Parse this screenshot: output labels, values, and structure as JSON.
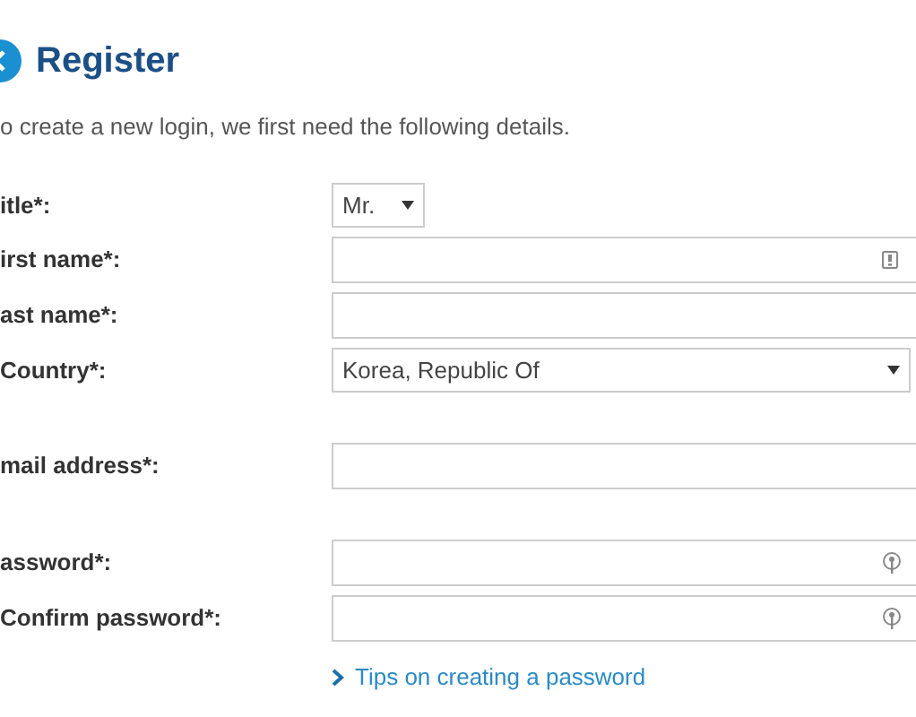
{
  "header": {
    "title": "Register"
  },
  "intro": "o create a new login, we first need the following details.",
  "sections": [
    [
      {
        "kind": "select",
        "label": "itle*:",
        "value": "Mr.",
        "compact": true
      },
      {
        "kind": "text",
        "label": "irst name*:",
        "autofill": true
      },
      {
        "kind": "text",
        "label": "ast name*:",
        "autofill": false
      },
      {
        "kind": "select",
        "label": "Country*:",
        "value": "Korea, Republic Of",
        "compact": false
      }
    ],
    [
      {
        "kind": "text",
        "label": "mail address*:",
        "autofill": false
      }
    ],
    [
      {
        "kind": "password",
        "label": "assword*:"
      },
      {
        "kind": "password",
        "label": "Confirm password*:"
      }
    ]
  ],
  "tips_link": "Tips on creating a password"
}
